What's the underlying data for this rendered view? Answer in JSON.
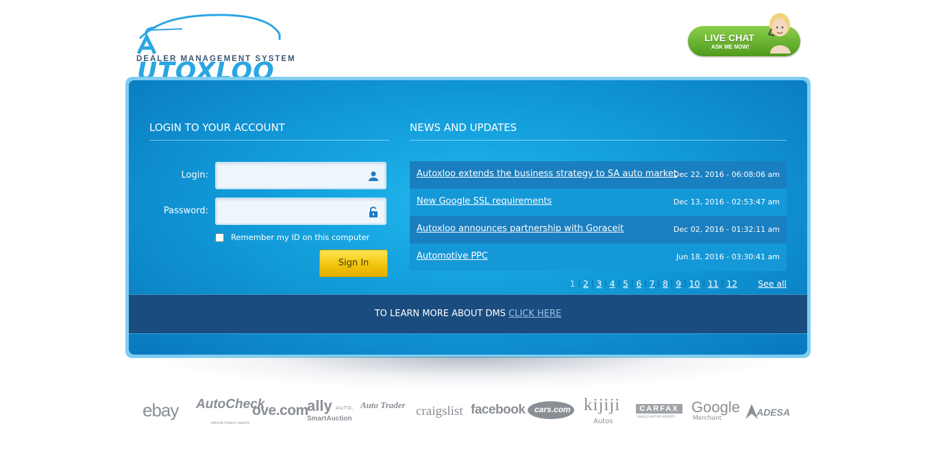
{
  "header": {
    "logo_text": "UTOXLOO",
    "logo_sub": "DEALER MANAGEMENT SYSTEM",
    "live_chat_title": "LIVE CHAT",
    "live_chat_sub": "ASK ME NOW!"
  },
  "login": {
    "title": "LOGIN TO YOUR ACCOUNT",
    "login_label": "Login:",
    "password_label": "Password:",
    "login_value": "",
    "password_value": "",
    "remember_label": "Remember my ID on this computer",
    "remember_checked": false,
    "signin_label": "Sign In"
  },
  "news": {
    "title": "NEWS AND UPDATES",
    "items": [
      {
        "title": "Autoxloo extends the business strategy to SA auto market",
        "date": "Dec 22, 2016 - 06:08:06 am"
      },
      {
        "title": "New Google SSL requirements",
        "date": "Dec 13, 2016 - 02:53:47 am"
      },
      {
        "title": "Autoxloo announces partnership with Goraceit",
        "date": "Dec 02, 2016 - 01:32:11 am"
      },
      {
        "title": "Automotive PPC",
        "date": "Jun 18, 2016 - 03:30:41 am"
      }
    ],
    "pages": [
      "1",
      "2",
      "3",
      "4",
      "5",
      "6",
      "7",
      "8",
      "9",
      "10",
      "11",
      "12"
    ],
    "current_page": "1",
    "see_all": "See all"
  },
  "dms": {
    "text": "TO LEARN MORE ABOUT DMS",
    "link": "CLICK HERE"
  },
  "partners": [
    "ebay",
    "AutoCheck",
    "ove.com",
    "ally",
    "Auto Trader",
    "craigslist",
    "facebook",
    "cars.com",
    "kijiji",
    "CARFAX",
    "Google",
    "ADESA"
  ],
  "partner_subtexts": {
    "autocheck": "vehicle history reports",
    "ally": "SmartAuction",
    "ally_auto": "AUTO.",
    "kijiji": "Autos",
    "carfax": "VEHICLE HISTORY REPORTS",
    "google": "Merchant"
  },
  "colors": {
    "panel_blue": "#139fdc",
    "dms_bar": "#1a4c7f",
    "signin_yellow": "#f0c20a",
    "chat_green": "#6bb52f"
  }
}
